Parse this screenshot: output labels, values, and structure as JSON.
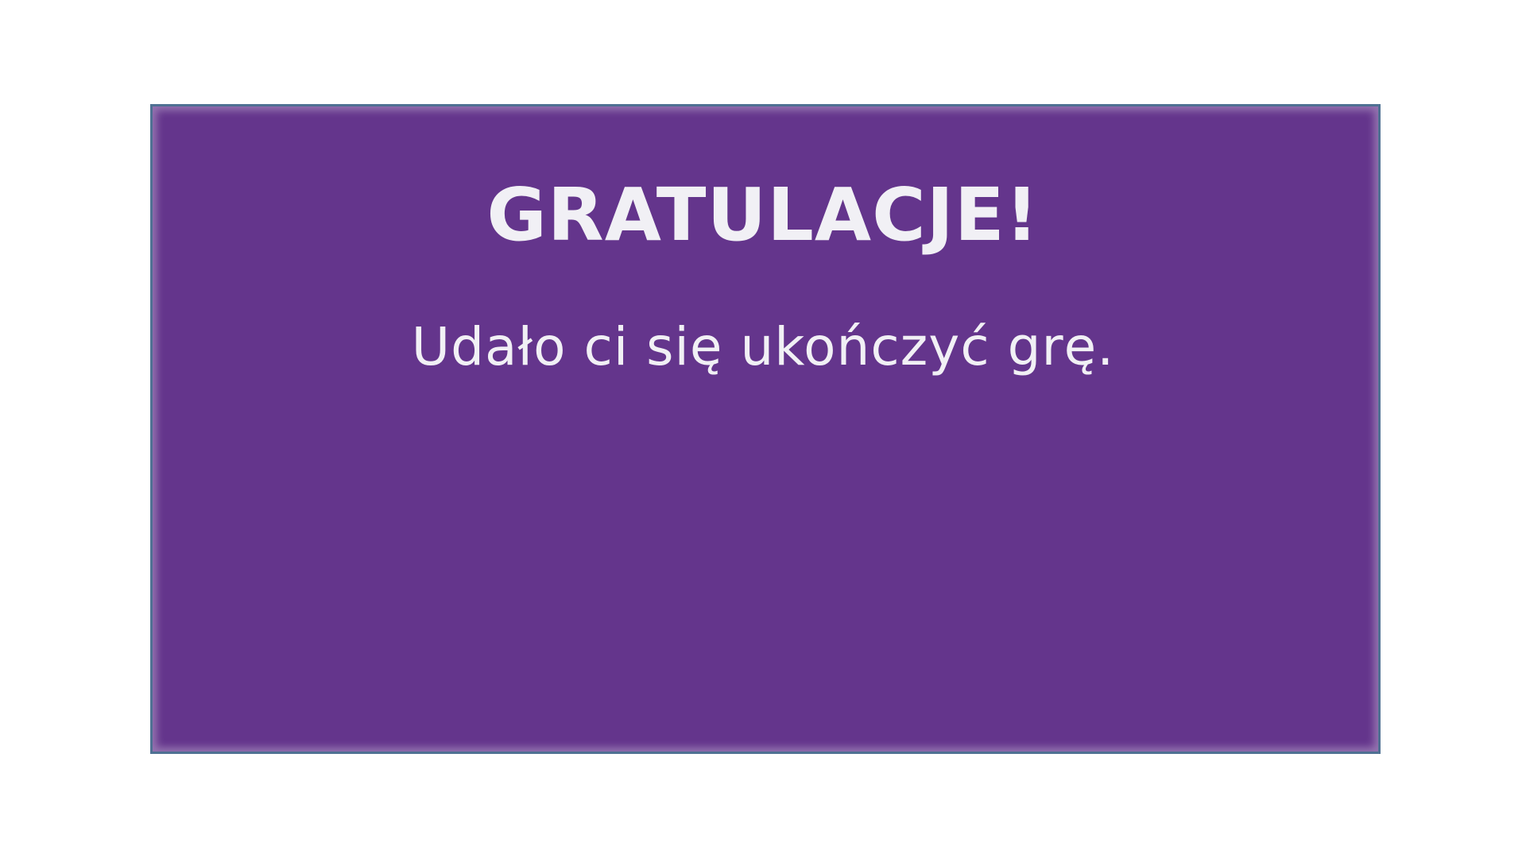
{
  "end_screen": {
    "title": "GRATULACJE!",
    "message": "Udało ci się ukończyć grę."
  },
  "colors": {
    "background": "#ffffff",
    "panel": "#64358c",
    "panel_border": "#4f7193",
    "text": "#f1f0f5"
  }
}
